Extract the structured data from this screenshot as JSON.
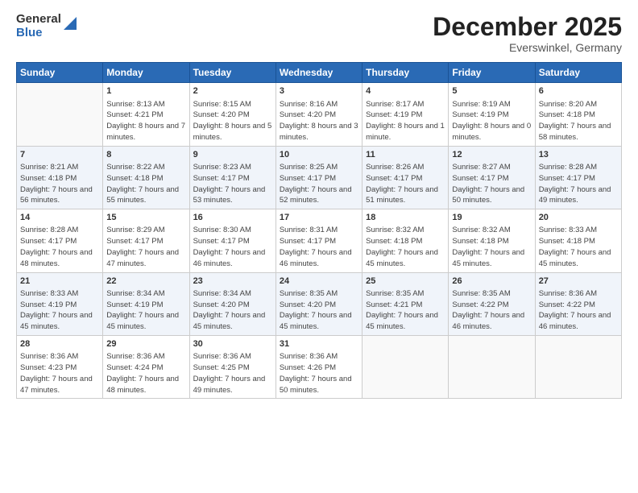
{
  "header": {
    "logo_general": "General",
    "logo_blue": "Blue",
    "month": "December 2025",
    "location": "Everswinkel, Germany"
  },
  "weekdays": [
    "Sunday",
    "Monday",
    "Tuesday",
    "Wednesday",
    "Thursday",
    "Friday",
    "Saturday"
  ],
  "weeks": [
    [
      {
        "day": "",
        "info": ""
      },
      {
        "day": "1",
        "info": "Sunrise: 8:13 AM\nSunset: 4:21 PM\nDaylight: 8 hours\nand 7 minutes."
      },
      {
        "day": "2",
        "info": "Sunrise: 8:15 AM\nSunset: 4:20 PM\nDaylight: 8 hours\nand 5 minutes."
      },
      {
        "day": "3",
        "info": "Sunrise: 8:16 AM\nSunset: 4:20 PM\nDaylight: 8 hours\nand 3 minutes."
      },
      {
        "day": "4",
        "info": "Sunrise: 8:17 AM\nSunset: 4:19 PM\nDaylight: 8 hours\nand 1 minute."
      },
      {
        "day": "5",
        "info": "Sunrise: 8:19 AM\nSunset: 4:19 PM\nDaylight: 8 hours\nand 0 minutes."
      },
      {
        "day": "6",
        "info": "Sunrise: 8:20 AM\nSunset: 4:18 PM\nDaylight: 7 hours\nand 58 minutes."
      }
    ],
    [
      {
        "day": "7",
        "info": "Sunrise: 8:21 AM\nSunset: 4:18 PM\nDaylight: 7 hours\nand 56 minutes."
      },
      {
        "day": "8",
        "info": "Sunrise: 8:22 AM\nSunset: 4:18 PM\nDaylight: 7 hours\nand 55 minutes."
      },
      {
        "day": "9",
        "info": "Sunrise: 8:23 AM\nSunset: 4:17 PM\nDaylight: 7 hours\nand 53 minutes."
      },
      {
        "day": "10",
        "info": "Sunrise: 8:25 AM\nSunset: 4:17 PM\nDaylight: 7 hours\nand 52 minutes."
      },
      {
        "day": "11",
        "info": "Sunrise: 8:26 AM\nSunset: 4:17 PM\nDaylight: 7 hours\nand 51 minutes."
      },
      {
        "day": "12",
        "info": "Sunrise: 8:27 AM\nSunset: 4:17 PM\nDaylight: 7 hours\nand 50 minutes."
      },
      {
        "day": "13",
        "info": "Sunrise: 8:28 AM\nSunset: 4:17 PM\nDaylight: 7 hours\nand 49 minutes."
      }
    ],
    [
      {
        "day": "14",
        "info": "Sunrise: 8:28 AM\nSunset: 4:17 PM\nDaylight: 7 hours\nand 48 minutes."
      },
      {
        "day": "15",
        "info": "Sunrise: 8:29 AM\nSunset: 4:17 PM\nDaylight: 7 hours\nand 47 minutes."
      },
      {
        "day": "16",
        "info": "Sunrise: 8:30 AM\nSunset: 4:17 PM\nDaylight: 7 hours\nand 46 minutes."
      },
      {
        "day": "17",
        "info": "Sunrise: 8:31 AM\nSunset: 4:17 PM\nDaylight: 7 hours\nand 46 minutes."
      },
      {
        "day": "18",
        "info": "Sunrise: 8:32 AM\nSunset: 4:18 PM\nDaylight: 7 hours\nand 45 minutes."
      },
      {
        "day": "19",
        "info": "Sunrise: 8:32 AM\nSunset: 4:18 PM\nDaylight: 7 hours\nand 45 minutes."
      },
      {
        "day": "20",
        "info": "Sunrise: 8:33 AM\nSunset: 4:18 PM\nDaylight: 7 hours\nand 45 minutes."
      }
    ],
    [
      {
        "day": "21",
        "info": "Sunrise: 8:33 AM\nSunset: 4:19 PM\nDaylight: 7 hours\nand 45 minutes."
      },
      {
        "day": "22",
        "info": "Sunrise: 8:34 AM\nSunset: 4:19 PM\nDaylight: 7 hours\nand 45 minutes."
      },
      {
        "day": "23",
        "info": "Sunrise: 8:34 AM\nSunset: 4:20 PM\nDaylight: 7 hours\nand 45 minutes."
      },
      {
        "day": "24",
        "info": "Sunrise: 8:35 AM\nSunset: 4:20 PM\nDaylight: 7 hours\nand 45 minutes."
      },
      {
        "day": "25",
        "info": "Sunrise: 8:35 AM\nSunset: 4:21 PM\nDaylight: 7 hours\nand 45 minutes."
      },
      {
        "day": "26",
        "info": "Sunrise: 8:35 AM\nSunset: 4:22 PM\nDaylight: 7 hours\nand 46 minutes."
      },
      {
        "day": "27",
        "info": "Sunrise: 8:36 AM\nSunset: 4:22 PM\nDaylight: 7 hours\nand 46 minutes."
      }
    ],
    [
      {
        "day": "28",
        "info": "Sunrise: 8:36 AM\nSunset: 4:23 PM\nDaylight: 7 hours\nand 47 minutes."
      },
      {
        "day": "29",
        "info": "Sunrise: 8:36 AM\nSunset: 4:24 PM\nDaylight: 7 hours\nand 48 minutes."
      },
      {
        "day": "30",
        "info": "Sunrise: 8:36 AM\nSunset: 4:25 PM\nDaylight: 7 hours\nand 49 minutes."
      },
      {
        "day": "31",
        "info": "Sunrise: 8:36 AM\nSunset: 4:26 PM\nDaylight: 7 hours\nand 50 minutes."
      },
      {
        "day": "",
        "info": ""
      },
      {
        "day": "",
        "info": ""
      },
      {
        "day": "",
        "info": ""
      }
    ]
  ]
}
